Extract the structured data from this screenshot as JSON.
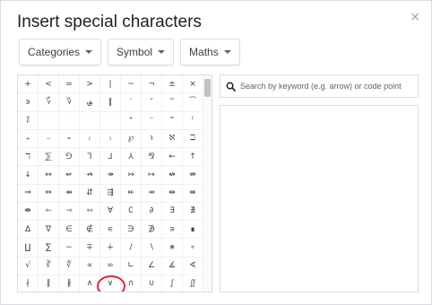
{
  "dialog": {
    "title": "Insert special characters",
    "close_glyph": "×"
  },
  "dropdowns": [
    {
      "label": "Categories"
    },
    {
      "label": "Symbol"
    },
    {
      "label": "Maths"
    }
  ],
  "search": {
    "placeholder": "Search by keyword (e.g. arrow) or code point"
  },
  "grid": {
    "columns": 9,
    "rows": [
      [
        "+",
        "<",
        "=",
        ">",
        "|",
        "~",
        "¬",
        "±",
        "×",
        "÷"
      ],
      [
        "϶",
        "؆",
        "؇",
        "؈",
        "‖",
        "′",
        "″",
        "‴",
        "⁀",
        "⁄"
      ],
      [
        "⁒",
        "",
        "",
        "",
        "",
        "⁺",
        "⁻",
        "⁼",
        "⁽",
        "⁾"
      ],
      [
        "₊",
        "₋",
        "₌",
        "₍",
        "₎",
        "℘",
        "℩",
        "ℵ",
        "ℶ",
        "ℷ"
      ],
      [
        "ℸ",
        "⅀",
        "⅁",
        "⅂",
        "⅃",
        "⅄",
        "⅋",
        "←",
        "↑",
        "→"
      ],
      [
        "↓",
        "↔",
        "↚",
        "↛",
        "↠",
        "↣",
        "↦",
        "↮",
        "⇎",
        "⇏"
      ],
      [
        "⇒",
        "⇔",
        "⇴",
        "⇵",
        "⇶",
        "⇷",
        "⇸",
        "⇹",
        "⇺",
        "⇻"
      ],
      [
        "⇼",
        "⇽",
        "⇾",
        "⇿",
        "∀",
        "∁",
        "∂",
        "∃",
        "∄",
        "∅"
      ],
      [
        "∆",
        "∇",
        "∈",
        "∉",
        "∊",
        "∋",
        "∌",
        "∍",
        "∎",
        "∏"
      ],
      [
        "∐",
        "∑",
        "−",
        "∓",
        "∔",
        "∕",
        "∖",
        "∗",
        "∘",
        "∙"
      ],
      [
        "√",
        "∛",
        "∜",
        "∝",
        "∞",
        "∟",
        "∠",
        "∡",
        "∢",
        "∣"
      ],
      [
        "∤",
        "∥",
        "∦",
        "∧",
        "∨",
        "∩",
        "∪",
        "∫",
        "∬",
        "∭"
      ]
    ],
    "highlighted_symbol": "∀"
  },
  "colors": {
    "highlight_ring": "#e4222b",
    "border": "#dadce0",
    "text": "#3c4043"
  },
  "icons": {
    "search": "search-icon",
    "close": "close-icon",
    "dropdown": "chevron-down-icon"
  }
}
